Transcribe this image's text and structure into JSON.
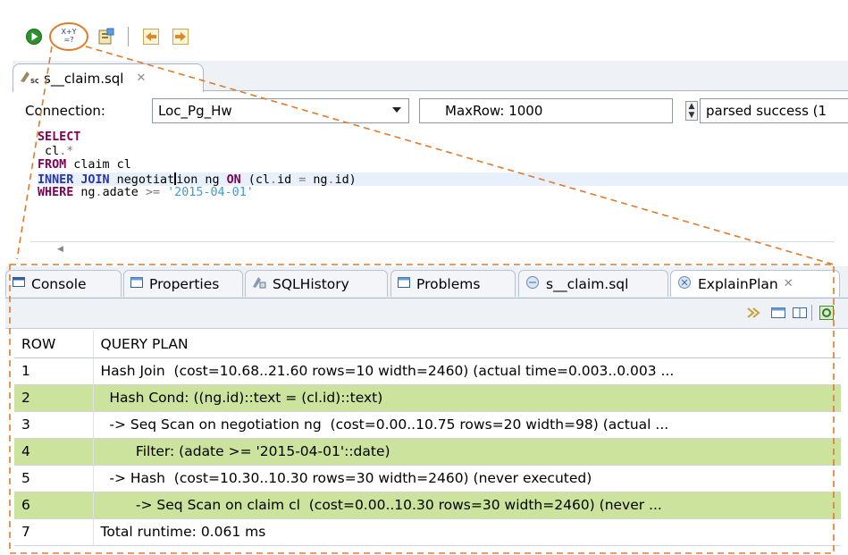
{
  "toolbar": {
    "buttons": [
      {
        "name": "run-icon",
        "label": ""
      },
      {
        "name": "explain-icon",
        "label": "X+Y\n=?"
      },
      {
        "name": "save-icon",
        "label": ""
      },
      {
        "name": "previous-icon",
        "label": ""
      },
      {
        "name": "next-icon",
        "label": ""
      }
    ]
  },
  "editor": {
    "tab_title": "s__claim.sql",
    "tab_icon_label": "SQL",
    "connection_label": "Connection:",
    "connection_value": "Loc_Pg_Hw",
    "maxrow_value": "MaxRow: 1000",
    "status_text": "parsed success (1",
    "code_lines": [
      [
        {
          "t": "SELECT",
          "c": "kw"
        }
      ],
      [
        {
          "t": " cl",
          "c": ""
        },
        {
          "t": ".",
          "c": "op"
        },
        {
          "t": "*",
          "c": "op"
        }
      ],
      [
        {
          "t": "FROM",
          "c": "kw"
        },
        {
          "t": " claim cl",
          "c": ""
        }
      ],
      [
        {
          "t": "INNER JOIN",
          "c": "kw-blue"
        },
        {
          "t": " negotiat",
          "c": ""
        },
        {
          "t": "|cursor|",
          "c": "cursor"
        },
        {
          "t": "ion ng ",
          "c": ""
        },
        {
          "t": "ON",
          "c": "kw"
        },
        {
          "t": " (cl",
          "c": ""
        },
        {
          "t": ".",
          "c": "op"
        },
        {
          "t": "id ",
          "c": ""
        },
        {
          "t": "=",
          "c": "op"
        },
        {
          "t": " ng",
          "c": ""
        },
        {
          "t": ".",
          "c": "op"
        },
        {
          "t": "id)",
          "c": ""
        }
      ],
      [
        {
          "t": "WHERE",
          "c": "kw"
        },
        {
          "t": " ng",
          "c": ""
        },
        {
          "t": ".",
          "c": "op"
        },
        {
          "t": "adate ",
          "c": ""
        },
        {
          "t": ">=",
          "c": "op"
        },
        {
          "t": " ",
          "c": ""
        },
        {
          "t": "'2015-04-01'",
          "c": "str"
        }
      ]
    ]
  },
  "views": {
    "tabs": [
      {
        "label": "Console",
        "icon": "console-icon",
        "active": false
      },
      {
        "label": "Properties",
        "icon": "properties-icon",
        "active": false
      },
      {
        "label": "SQLHistory",
        "icon": "sqlhistory-icon",
        "active": false
      },
      {
        "label": "Problems",
        "icon": "problems-icon",
        "active": false
      },
      {
        "label": "s__claim.sql",
        "icon": "sql-result-icon",
        "active": false
      },
      {
        "label": "ExplainPlan",
        "icon": "explainplan-icon",
        "active": true
      }
    ],
    "plan": {
      "columns": [
        "ROW",
        "QUERY PLAN"
      ],
      "rows": [
        [
          "1",
          "Hash Join  (cost=10.68..21.60 rows=10 width=2460) (actual time=0.003..0.003 ..."
        ],
        [
          "2",
          "  Hash Cond: ((ng.id)::text = (cl.id)::text)"
        ],
        [
          "3",
          "  -> Seq Scan on negotiation ng  (cost=0.00..10.75 rows=20 width=98) (actual ..."
        ],
        [
          "4",
          "        Filter: (adate >= '2015-04-01'::date)"
        ],
        [
          "5",
          "  -> Hash  (cost=10.30..10.30 rows=30 width=2460) (never executed)"
        ],
        [
          "6",
          "        -> Seq Scan on claim cl  (cost=0.00..10.30 rows=30 width=2460) (never ..."
        ],
        [
          "7",
          "Total runtime: 0.061 ms"
        ]
      ]
    }
  },
  "colors": {
    "row_highlight": "#cbe39c",
    "annotation": "#e27a2a",
    "keyword": "#7f0055",
    "string": "#3a9bd6"
  }
}
